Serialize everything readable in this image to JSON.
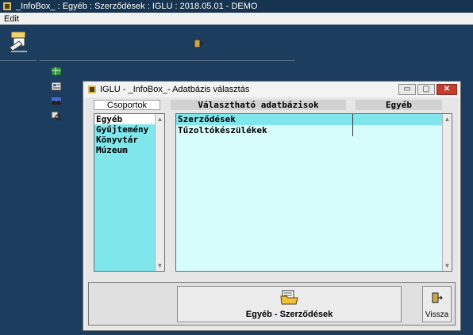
{
  "app": {
    "title": "_InfoBox_ : Egyéb  : Szerződések : IGLU : 2018.05.01 - DEMO",
    "menu": [
      "Edit"
    ]
  },
  "dialog": {
    "title": "IGLU - _InfoBox_- Adatbázis választás",
    "controls": {
      "minimize": "▭",
      "maximize": "▢",
      "close": "✕"
    },
    "headers": {
      "groups": "Csoportok",
      "databases": "Választható adatbázisok",
      "other": "Egyéb"
    },
    "groups": [
      {
        "label": "Egyéb",
        "selected": true
      },
      {
        "label": "Gyűjtemény",
        "selected": false
      },
      {
        "label": "Könyvtár",
        "selected": false
      },
      {
        "label": "Múzeum",
        "selected": false
      }
    ],
    "databases": [
      {
        "label": "Szerződések",
        "selected": true
      },
      {
        "label": "Tűzoltókészülékek",
        "selected": false
      }
    ],
    "confirm_label": "Egyéb - Szerződések",
    "back_label": "Vissza"
  },
  "icons": {
    "app": "app-icon",
    "logo": "wrench-logo-icon",
    "exit": "exit-door-icon",
    "side": [
      "table-icon",
      "form-icon",
      "binoculars-icon",
      "search-tool-icon"
    ],
    "confirm": "folder-icon",
    "back": "exit-door-icon"
  },
  "colors": {
    "background": "#1d3d5e",
    "list_cyan": "#7fe6ec",
    "list_light_cyan": "#d6fcfc",
    "close_red": "#c43c2e"
  }
}
